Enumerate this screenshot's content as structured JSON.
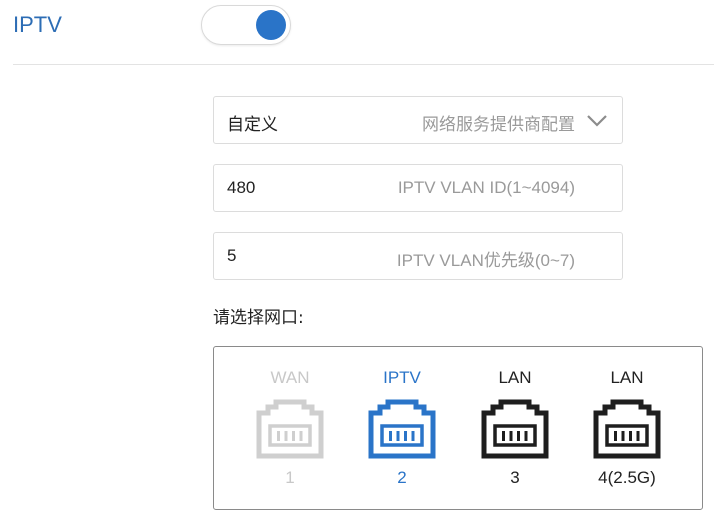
{
  "header": {
    "title": "IPTV",
    "toggle_on": true
  },
  "mode_select": {
    "value": "自定义",
    "placeholder": "网络服务提供商配置"
  },
  "vlan_id": {
    "value": "480",
    "placeholder": "IPTV VLAN ID(1~4094)"
  },
  "vlan_priority": {
    "value": "5",
    "placeholder": "IPTV VLAN优先级(0~7)"
  },
  "ports_label": "请选择网口:",
  "ports": [
    {
      "name": "WAN",
      "number": "1",
      "state": "disabled",
      "color": "#cfcfcf",
      "text_color": "#c8c8c8"
    },
    {
      "name": "IPTV",
      "number": "2",
      "state": "selected",
      "color": "#2a74c8",
      "text_color": "#2a74c8"
    },
    {
      "name": "LAN",
      "number": "3",
      "state": "normal",
      "color": "#1e1e1e",
      "text_color": "#222222"
    },
    {
      "name": "LAN",
      "number": "4(2.5G)",
      "state": "normal",
      "color": "#1e1e1e",
      "text_color": "#222222"
    }
  ],
  "colors": {
    "accent": "#2a74c8"
  }
}
